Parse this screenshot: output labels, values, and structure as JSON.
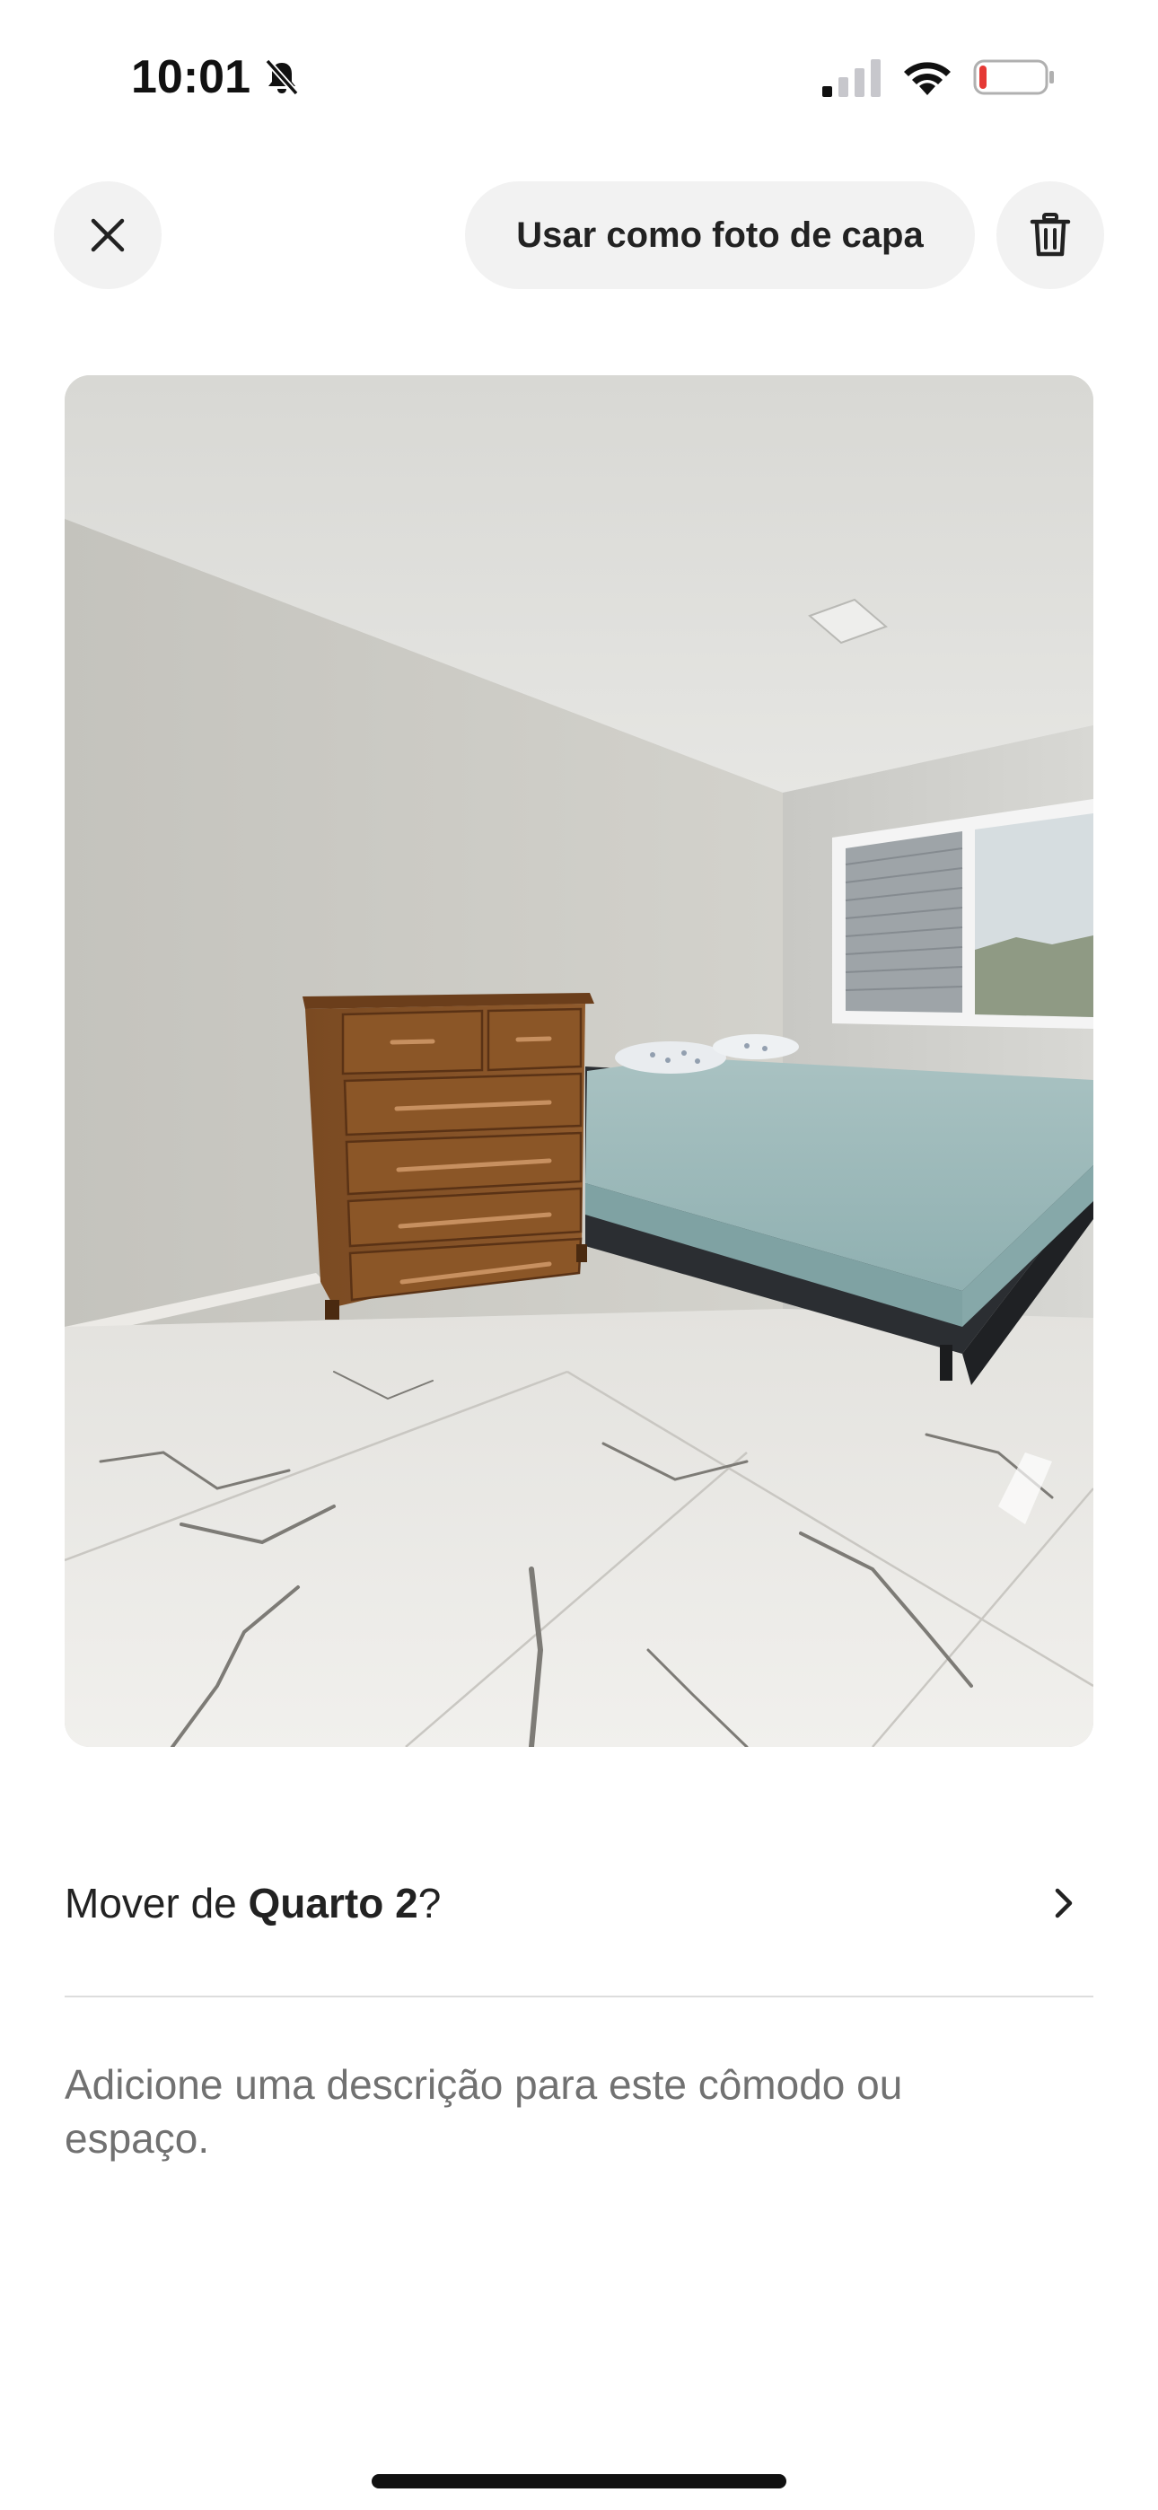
{
  "status_bar": {
    "time": "10:01",
    "icons": [
      "bell-slash-icon",
      "cellular-signal-icon",
      "wifi-icon",
      "battery-low-icon"
    ],
    "battery_level": 0.12,
    "battery_color": "#e53935"
  },
  "header": {
    "close_icon": "close-icon",
    "cover_button_label": "Usar como foto de capa",
    "delete_icon": "trash-icon"
  },
  "photo": {
    "subject": "bedroom-photo"
  },
  "move_row": {
    "prefix": "Mover de ",
    "room_name": "Quarto 2",
    "suffix": "?",
    "icon": "chevron-right-icon"
  },
  "description": {
    "placeholder": "Adicione uma descrição para este cômodo ou espaço."
  },
  "colors": {
    "button_background": "#f2f2f2",
    "text_primary": "#222222",
    "text_secondary": "#717171",
    "divider": "#dddddd"
  }
}
